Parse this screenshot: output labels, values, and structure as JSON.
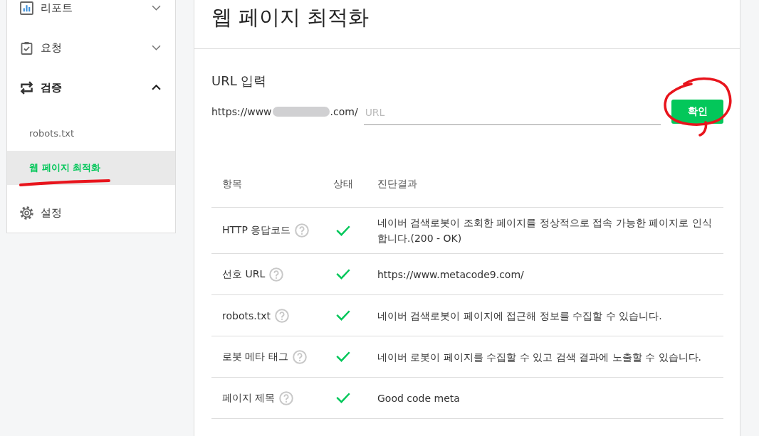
{
  "sidebar": {
    "items": [
      {
        "label": "리포트",
        "expanded": false
      },
      {
        "label": "요청",
        "expanded": false
      },
      {
        "label": "검증",
        "expanded": true,
        "children": [
          {
            "label": "robots.txt",
            "selected": false
          },
          {
            "label": "웹 페이지 최적화",
            "selected": true
          }
        ]
      },
      {
        "label": "설정"
      }
    ]
  },
  "page": {
    "title": "웹 페이지 최적화"
  },
  "url_form": {
    "label": "URL 입력",
    "prefix_start": "https://www",
    "prefix_end": ".com/",
    "placeholder": "URL",
    "button": "확인"
  },
  "table": {
    "columns": [
      "항목",
      "상태",
      "진단결과"
    ],
    "rows": [
      {
        "item": "HTTP 응답코드",
        "passed": true,
        "result": "네이버 검색로봇이 조회한 페이지를 정상적으로 접속 가능한 페이지로 인식합니다.(200 - OK)"
      },
      {
        "item": "선호 URL",
        "passed": true,
        "result": "https://www.metacode9.com/"
      },
      {
        "item": "robots.txt",
        "passed": true,
        "result": "네이버 검색로봇이 페이지에 접근해 정보를 수집할 수 있습니다."
      },
      {
        "item": "로봇 메타 태그",
        "passed": true,
        "result": "네이버 로봇이 페이지를 수집할 수 있고 검색 결과에 노출할 수 있습니다."
      },
      {
        "item": "페이지 제목",
        "passed": true,
        "result": "Good code meta"
      }
    ]
  }
}
